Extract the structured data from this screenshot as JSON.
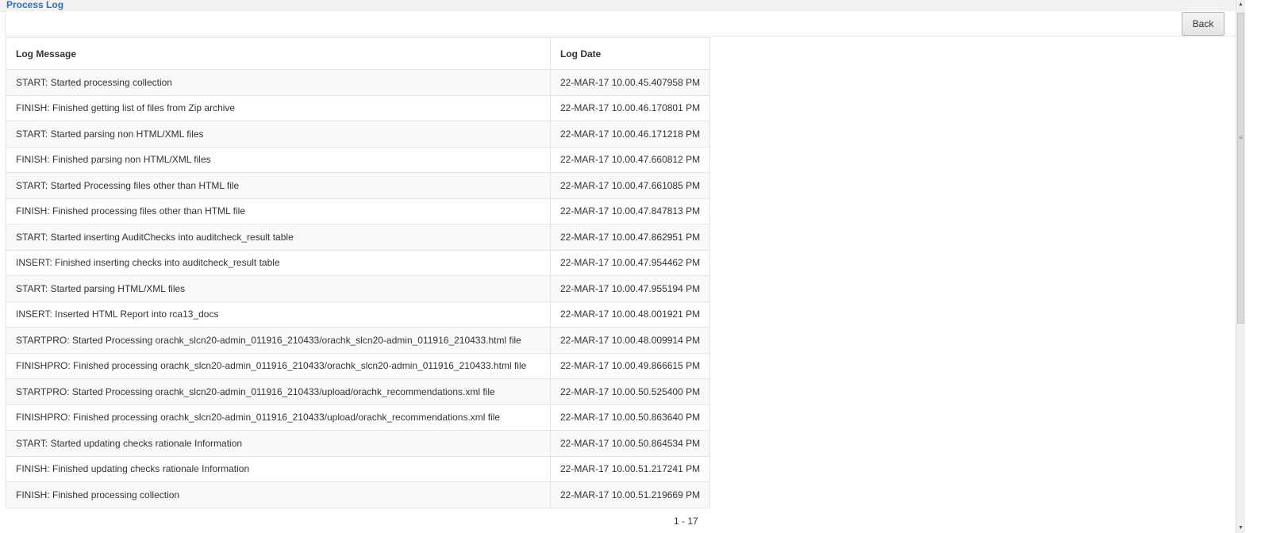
{
  "page": {
    "title": "Process Log",
    "back_label": "Back",
    "pagination": "1 - 17"
  },
  "table": {
    "headers": {
      "message": "Log Message",
      "date": "Log Date"
    },
    "rows": [
      {
        "message": "START: Started processing collection",
        "date": "22-MAR-17 10.00.45.407958 PM"
      },
      {
        "message": "FINISH: Finished getting list of files from Zip archive",
        "date": "22-MAR-17 10.00.46.170801 PM"
      },
      {
        "message": "START: Started parsing non HTML/XML files",
        "date": "22-MAR-17 10.00.46.171218 PM"
      },
      {
        "message": "FINISH: Finished parsing non HTML/XML files",
        "date": "22-MAR-17 10.00.47.660812 PM"
      },
      {
        "message": "START: Started Processing files other than HTML file",
        "date": "22-MAR-17 10.00.47.661085 PM"
      },
      {
        "message": "FINISH: Finished processing files other than HTML file",
        "date": "22-MAR-17 10.00.47.847813 PM"
      },
      {
        "message": "START: Started inserting AuditChecks into auditcheck_result table",
        "date": "22-MAR-17 10.00.47.862951 PM"
      },
      {
        "message": "INSERT: Finished inserting checks into auditcheck_result table",
        "date": "22-MAR-17 10.00.47.954462 PM"
      },
      {
        "message": "START: Started parsing HTML/XML files",
        "date": "22-MAR-17 10.00.47.955194 PM"
      },
      {
        "message": "INSERT: Inserted HTML Report into rca13_docs",
        "date": "22-MAR-17 10.00.48.001921 PM"
      },
      {
        "message": "STARTPRO: Started Processing orachk_slcn20-admin_011916_210433/orachk_slcn20-admin_011916_210433.html file",
        "date": "22-MAR-17 10.00.48.009914 PM"
      },
      {
        "message": "FINISHPRO: Finished processing orachk_slcn20-admin_011916_210433/orachk_slcn20-admin_011916_210433.html file",
        "date": "22-MAR-17 10.00.49.866615 PM"
      },
      {
        "message": "STARTPRO: Started Processing orachk_slcn20-admin_011916_210433/upload/orachk_recommendations.xml file",
        "date": "22-MAR-17 10.00.50.525400 PM"
      },
      {
        "message": "FINISHPRO: Finished processing orachk_slcn20-admin_011916_210433/upload/orachk_recommendations.xml file",
        "date": "22-MAR-17 10.00.50.863640 PM"
      },
      {
        "message": "START: Started updating checks rationale Information",
        "date": "22-MAR-17 10.00.50.864534 PM"
      },
      {
        "message": "FINISH: Finished updating checks rationale Information",
        "date": "22-MAR-17 10.00.51.217241 PM"
      },
      {
        "message": "FINISH: Finished processing collection",
        "date": "22-MAR-17 10.00.51.219669 PM"
      }
    ]
  },
  "icons": {
    "scroll_up": "scroll-up-arrow-icon",
    "scroll_down": "scroll-down-arrow-icon",
    "scroll_grip": "scroll-grip-icon"
  },
  "colors": {
    "title": "#2f6fb3",
    "row_alt": "#f9f9f9",
    "border": "#e3e3e3"
  }
}
